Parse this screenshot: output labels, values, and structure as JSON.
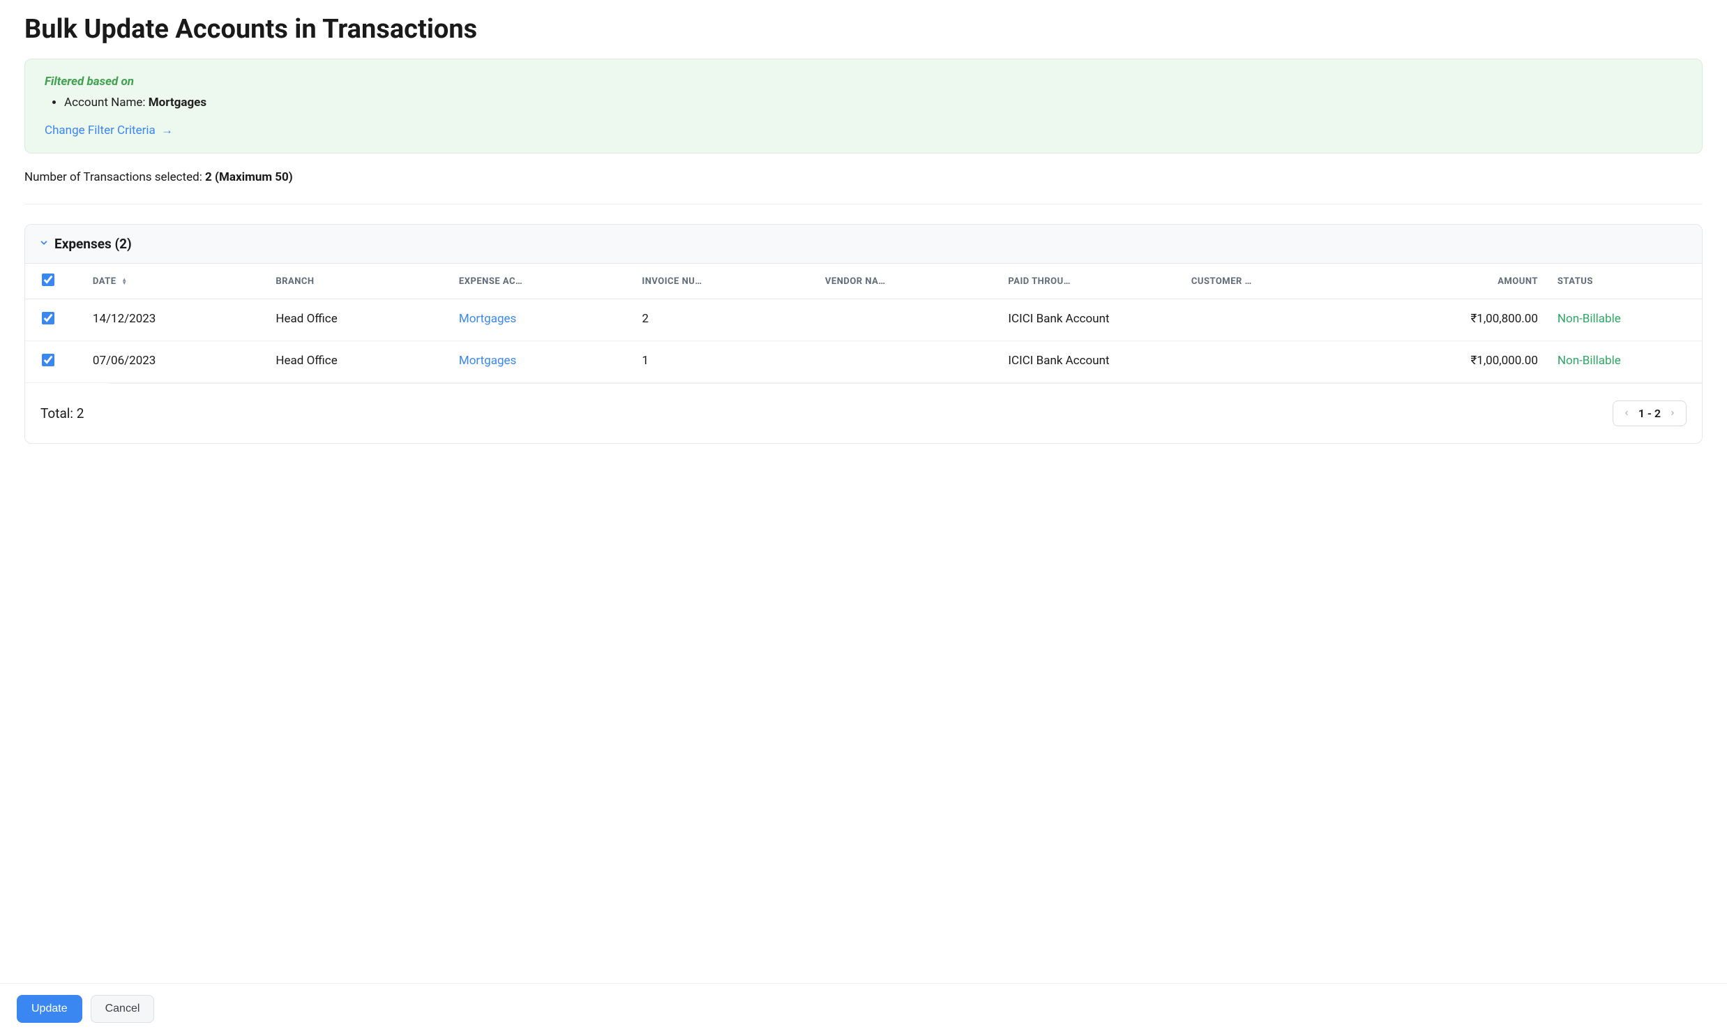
{
  "page_title": "Bulk Update Accounts in Transactions",
  "filter_panel": {
    "label": "Filtered based on",
    "criteria": [
      {
        "key": "Account Name: ",
        "value": "Mortgages"
      }
    ],
    "change_link_text": "Change Filter Criteria",
    "arrow": "→"
  },
  "selection": {
    "prefix": "Number of Transactions selected: ",
    "value": "2 (Maximum 50)"
  },
  "section": {
    "title": "Expenses (2)"
  },
  "table": {
    "headers": {
      "date": "DATE",
      "branch": "BRANCH",
      "expense_account": "EXPENSE AC…",
      "invoice_number": "INVOICE NU…",
      "vendor_name": "VENDOR NA…",
      "paid_through": "PAID THROU…",
      "customer_name": "CUSTOMER …",
      "amount": "AMOUNT",
      "status": "STATUS"
    },
    "rows": [
      {
        "selected": true,
        "date": "14/12/2023",
        "branch": "Head Office",
        "expense_account": "Mortgages",
        "invoice_number": "2",
        "vendor_name": "",
        "paid_through": "ICICI Bank Account",
        "customer_name": "",
        "amount": "₹1,00,800.00",
        "status": "Non-Billable"
      },
      {
        "selected": true,
        "date": "07/06/2023",
        "branch": "Head Office",
        "expense_account": "Mortgages",
        "invoice_number": "1",
        "vendor_name": "",
        "paid_through": "ICICI Bank Account",
        "customer_name": "",
        "amount": "₹1,00,000.00",
        "status": "Non-Billable"
      }
    ]
  },
  "footer": {
    "total_label": "Total: 2",
    "pager_range": "1 - 2"
  },
  "buttons": {
    "update": "Update",
    "cancel": "Cancel"
  }
}
